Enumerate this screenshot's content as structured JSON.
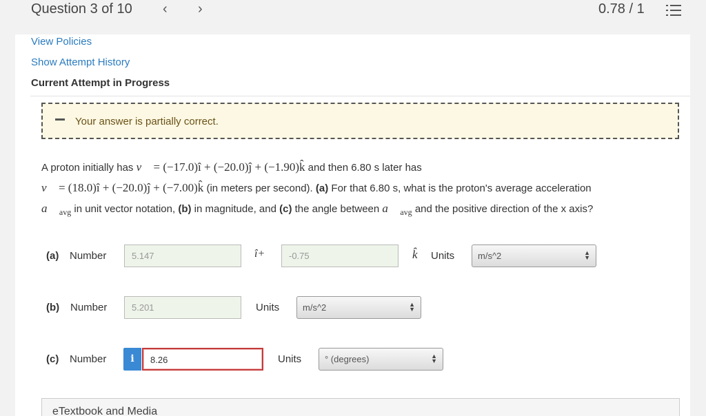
{
  "header": {
    "question_label": "Question 3 of 10",
    "prev_icon": "chevron-left-icon",
    "next_icon": "chevron-right-icon",
    "score": "0.78 / 1",
    "menu_icon": "list-icon"
  },
  "links": {
    "view_policies": "View Policies",
    "show_history": "Show Attempt History"
  },
  "attempt_status": "Current Attempt in Progress",
  "feedback": {
    "message": "Your answer is partially correct.",
    "color": "#fcf8e3"
  },
  "problem": {
    "t1": "A proton initially has",
    "v_initial": "= (−17.0)î + (−20.0)ĵ + (−1.90)k̂",
    "t2": "and then 6.80 s later has",
    "v_final": "= (18.0)î + (−20.0)ĵ + (−7.00)k̂",
    "t3": "(in meters per second).",
    "a_label": "(a)",
    "t4": "For that 6.80 s, what is the proton's average acceleration",
    "sub_avg": "avg",
    "t5": "in unit vector notation,",
    "b_label": "(b)",
    "t6": "in magnitude, and",
    "c_label": "(c)",
    "t7": "the angle between",
    "t8": "and the positive direction of the x axis?"
  },
  "answers": {
    "a": {
      "label": "(a)",
      "number_label": "Number",
      "value_i": "5.147",
      "i_suffix": "î+",
      "value_k": "-0.75",
      "k_symbol": "k̂",
      "units_label": "Units",
      "units": "m/s^2"
    },
    "b": {
      "label": "(b)",
      "number_label": "Number",
      "value": "5.201",
      "units_label": "Units",
      "units": "m/s^2"
    },
    "c": {
      "label": "(c)",
      "number_label": "Number",
      "info_icon": "info-icon",
      "info_glyph": "i",
      "value": "8.26",
      "units_label": "Units",
      "units": "° (degrees)"
    }
  },
  "media": {
    "title": "eTextbook and Media"
  },
  "colors": {
    "link": "#2a7bbf",
    "error_border": "#c43b3b",
    "info_button": "#3a89d4"
  }
}
